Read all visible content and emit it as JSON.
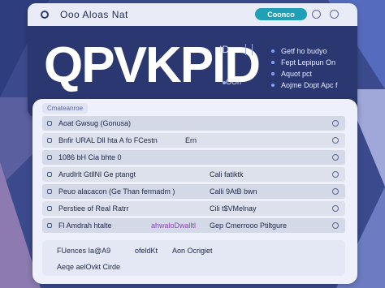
{
  "colors": {
    "background": "#3b4a8c",
    "window": "#2b3770",
    "titlebar": "#e9ecf7",
    "accent_button": "#1fa0b7",
    "panel": "#eef1fb",
    "highlight_text": "#8a4ab8"
  },
  "titlebar": {
    "title": "Ooo Aloas  Nat",
    "button_label": "Coonco",
    "icon": "target-icon"
  },
  "hero": {
    "title": "QPVKPID",
    "tag": "ID",
    "small": "OOn",
    "links": [
      "Getf ho budyo",
      "Fept Lepipun On",
      "Aquot pct",
      "Aojme Dopt Apc f"
    ]
  },
  "panel": {
    "tab_label": "Cmateanroe",
    "rows": [
      {
        "c1": "Aoat  Gwsug  (Gonusa)",
        "c2": "",
        "c3": ""
      },
      {
        "c1": "Bnfir URAL Dll  hta  A fo FCestn",
        "c2": "Ern",
        "c3": ""
      },
      {
        "c1": "1086  bH  Cia   bhte 0",
        "c2": "",
        "c3": ""
      },
      {
        "c1": "Arudlrlt  GtllNl Ge ptangt",
        "c2": "",
        "c3": "Cali fatiktk"
      },
      {
        "c1": "Peuo  alacacon  (Ge Than fermadm  )",
        "c2": "",
        "c3": "Calli 9AtB bwn"
      },
      {
        "c1": "Perstiee  of  Real Ratrr",
        "c2": "",
        "c3": "Cili t$VMelnay"
      },
      {
        "c1": "Fl Amdrah  htalte",
        "c2": "ahwaloDwalltl",
        "c3": "Gep Cmerrooo Ptiltgure"
      }
    ]
  },
  "footer": {
    "line1_left": "FUences  Ia@A9",
    "line1_mid": "ofeldKt",
    "line1_right": "Aon Ocrigiet",
    "line2_left": "Aeqe  aelOvkt  Cirde"
  }
}
